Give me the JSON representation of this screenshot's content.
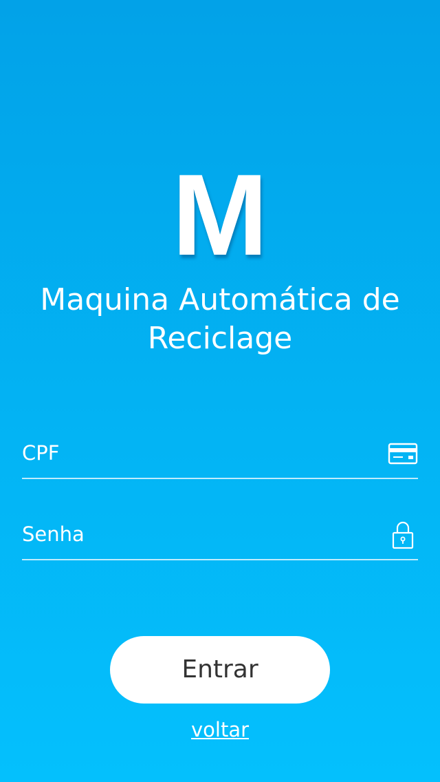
{
  "logo": {
    "letter": "M"
  },
  "title": {
    "line1": "Maquina Automática de",
    "line2": "Reciclage"
  },
  "form": {
    "cpf": {
      "placeholder": "CPF",
      "value": "",
      "icon": "credit-card-icon"
    },
    "senha": {
      "placeholder": "Senha",
      "value": "",
      "icon": "padlock-icon"
    }
  },
  "actions": {
    "entrar_label": "Entrar",
    "voltar_label": "voltar"
  },
  "colors": {
    "background_top": "#02a2e8",
    "background_bottom": "#04c0fd",
    "button_bg": "#ffffff",
    "button_text": "#333333",
    "text": "#ffffff"
  }
}
